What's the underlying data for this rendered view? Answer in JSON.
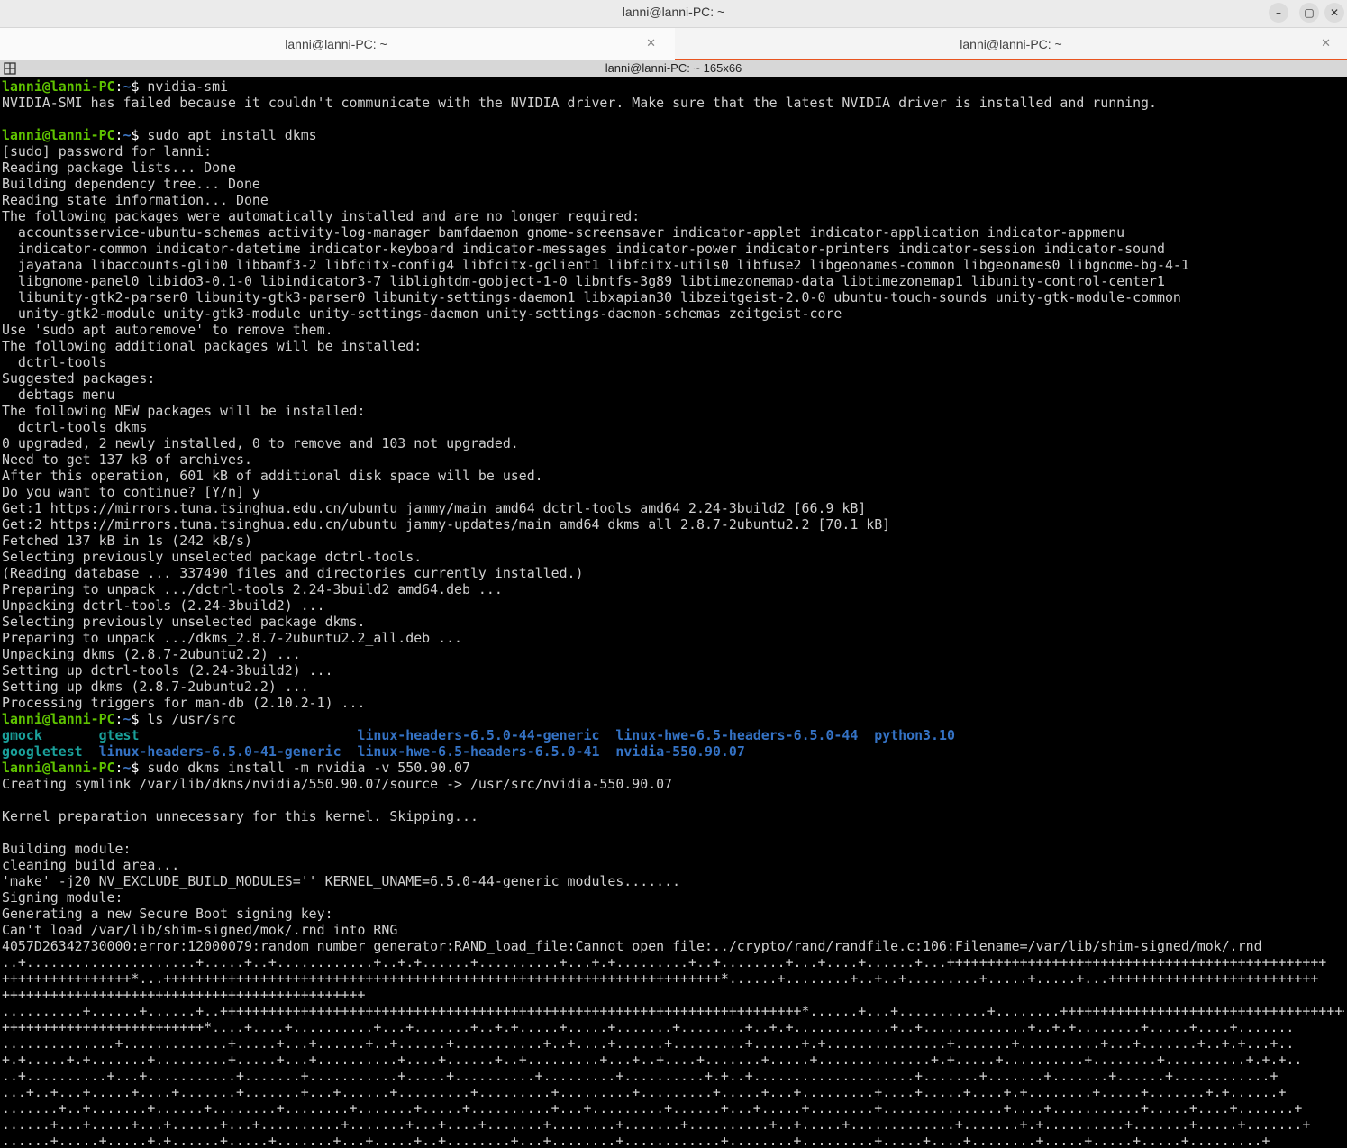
{
  "window": {
    "title": "lanni@lanni-PC: ~",
    "controls": {
      "minimize": "–",
      "maximize": "▢",
      "close": "✕"
    }
  },
  "tabs": [
    {
      "label": "lanni@lanni-PC: ~",
      "close": "✕",
      "active": false
    },
    {
      "label": "lanni@lanni-PC: ~",
      "close": "✕",
      "active": true
    }
  ],
  "header": {
    "title": "lanni@lanni-PC: ~ 165x66"
  },
  "colors": {
    "accent": "#e95420",
    "prompt_user": "#5fc300",
    "prompt_path": "#3f78c6",
    "dir_teal": "#1aa19b",
    "dir_blue": "#3472c4",
    "bg": "#000000"
  },
  "terminal": {
    "lines": [
      {
        "type": "prompt",
        "user": "lanni@lanni-PC",
        "path": "~",
        "cmd": " nvidia-smi"
      },
      {
        "type": "out",
        "text": "NVIDIA-SMI has failed because it couldn't communicate with the NVIDIA driver. Make sure that the latest NVIDIA driver is installed and running."
      },
      {
        "type": "out",
        "text": ""
      },
      {
        "type": "prompt",
        "user": "lanni@lanni-PC",
        "path": "~",
        "cmd": " sudo apt install dkms"
      },
      {
        "type": "out",
        "text": "[sudo] password for lanni:"
      },
      {
        "type": "out",
        "text": "Reading package lists... Done"
      },
      {
        "type": "out",
        "text": "Building dependency tree... Done"
      },
      {
        "type": "out",
        "text": "Reading state information... Done"
      },
      {
        "type": "out",
        "text": "The following packages were automatically installed and are no longer required:"
      },
      {
        "type": "out",
        "text": "  accountsservice-ubuntu-schemas activity-log-manager bamfdaemon gnome-screensaver indicator-applet indicator-application indicator-appmenu"
      },
      {
        "type": "out",
        "text": "  indicator-common indicator-datetime indicator-keyboard indicator-messages indicator-power indicator-printers indicator-session indicator-sound"
      },
      {
        "type": "out",
        "text": "  jayatana libaccounts-glib0 libbamf3-2 libfcitx-config4 libfcitx-gclient1 libfcitx-utils0 libfuse2 libgeonames-common libgeonames0 libgnome-bg-4-1"
      },
      {
        "type": "out",
        "text": "  libgnome-panel0 libido3-0.1-0 libindicator3-7 liblightdm-gobject-1-0 libntfs-3g89 libtimezonemap-data libtimezonemap1 libunity-control-center1"
      },
      {
        "type": "out",
        "text": "  libunity-gtk2-parser0 libunity-gtk3-parser0 libunity-settings-daemon1 libxapian30 libzeitgeist-2.0-0 ubuntu-touch-sounds unity-gtk-module-common"
      },
      {
        "type": "out",
        "text": "  unity-gtk2-module unity-gtk3-module unity-settings-daemon unity-settings-daemon-schemas zeitgeist-core"
      },
      {
        "type": "out",
        "text": "Use 'sudo apt autoremove' to remove them."
      },
      {
        "type": "out",
        "text": "The following additional packages will be installed:"
      },
      {
        "type": "out",
        "text": "  dctrl-tools"
      },
      {
        "type": "out",
        "text": "Suggested packages:"
      },
      {
        "type": "out",
        "text": "  debtags menu"
      },
      {
        "type": "out",
        "text": "The following NEW packages will be installed:"
      },
      {
        "type": "out",
        "text": "  dctrl-tools dkms"
      },
      {
        "type": "out",
        "text": "0 upgraded, 2 newly installed, 0 to remove and 103 not upgraded."
      },
      {
        "type": "out",
        "text": "Need to get 137 kB of archives."
      },
      {
        "type": "out",
        "text": "After this operation, 601 kB of additional disk space will be used."
      },
      {
        "type": "out",
        "text": "Do you want to continue? [Y/n] y"
      },
      {
        "type": "out",
        "text": "Get:1 https://mirrors.tuna.tsinghua.edu.cn/ubuntu jammy/main amd64 dctrl-tools amd64 2.24-3build2 [66.9 kB]"
      },
      {
        "type": "out",
        "text": "Get:2 https://mirrors.tuna.tsinghua.edu.cn/ubuntu jammy-updates/main amd64 dkms all 2.8.7-2ubuntu2.2 [70.1 kB]"
      },
      {
        "type": "out",
        "text": "Fetched 137 kB in 1s (242 kB/s)"
      },
      {
        "type": "out",
        "text": "Selecting previously unselected package dctrl-tools."
      },
      {
        "type": "out",
        "text": "(Reading database ... 337490 files and directories currently installed.)"
      },
      {
        "type": "out",
        "text": "Preparing to unpack .../dctrl-tools_2.24-3build2_amd64.deb ..."
      },
      {
        "type": "out",
        "text": "Unpacking dctrl-tools (2.24-3build2) ..."
      },
      {
        "type": "out",
        "text": "Selecting previously unselected package dkms."
      },
      {
        "type": "out",
        "text": "Preparing to unpack .../dkms_2.8.7-2ubuntu2.2_all.deb ..."
      },
      {
        "type": "out",
        "text": "Unpacking dkms (2.8.7-2ubuntu2.2) ..."
      },
      {
        "type": "out",
        "text": "Setting up dctrl-tools (2.24-3build2) ..."
      },
      {
        "type": "out",
        "text": "Setting up dkms (2.8.7-2ubuntu2.2) ..."
      },
      {
        "type": "out",
        "text": "Processing triggers for man-db (2.10.2-1) ..."
      },
      {
        "type": "prompt",
        "user": "lanni@lanni-PC",
        "path": "~",
        "cmd": " ls /usr/src"
      },
      {
        "type": "ls",
        "cells": [
          {
            "text": "gmock       ",
            "cls": "dir-green"
          },
          {
            "text": "gtest                           ",
            "cls": "dir-green"
          },
          {
            "text": "linux-headers-6.5.0-44-generic",
            "cls": "dir-blue"
          },
          {
            "text": "  ",
            "cls": ""
          },
          {
            "text": "linux-hwe-6.5-headers-6.5.0-44",
            "cls": "dir-blue"
          },
          {
            "text": "  ",
            "cls": ""
          },
          {
            "text": "python3.10",
            "cls": "dir-blue"
          }
        ]
      },
      {
        "type": "ls",
        "cells": [
          {
            "text": "googletest",
            "cls": "dir-green"
          },
          {
            "text": "  ",
            "cls": ""
          },
          {
            "text": "linux-headers-6.5.0-41-generic",
            "cls": "dir-blue"
          },
          {
            "text": "  ",
            "cls": ""
          },
          {
            "text": "linux-hwe-6.5-headers-6.5.0-41",
            "cls": "dir-blue"
          },
          {
            "text": "  ",
            "cls": ""
          },
          {
            "text": "nvidia-550.90.07",
            "cls": "dir-blue"
          }
        ]
      },
      {
        "type": "prompt",
        "user": "lanni@lanni-PC",
        "path": "~",
        "cmd": " sudo dkms install -m nvidia -v 550.90.07"
      },
      {
        "type": "out",
        "text": "Creating symlink /var/lib/dkms/nvidia/550.90.07/source -> /usr/src/nvidia-550.90.07"
      },
      {
        "type": "out",
        "text": ""
      },
      {
        "type": "out",
        "text": "Kernel preparation unnecessary for this kernel. Skipping..."
      },
      {
        "type": "out",
        "text": ""
      },
      {
        "type": "out",
        "text": "Building module:"
      },
      {
        "type": "out",
        "text": "cleaning build area..."
      },
      {
        "type": "out",
        "text": "'make' -j20 NV_EXCLUDE_BUILD_MODULES='' KERNEL_UNAME=6.5.0-44-generic modules......."
      },
      {
        "type": "out",
        "text": "Signing module:"
      },
      {
        "type": "out",
        "text": "Generating a new Secure Boot signing key:"
      },
      {
        "type": "out",
        "text": "Can't load /var/lib/shim-signed/mok/.rnd into RNG"
      },
      {
        "type": "out",
        "text": "4057D26342730000:error:12000079:random number generator:RAND_load_file:Cannot open file:../crypto/rand/randfile.c:106:Filename=/var/lib/shim-signed/mok/.rnd"
      },
      {
        "type": "out",
        "text": "..+.....................+.....+..+............+..+.+......+..........+...+.+.........+..+........+...+....+......+...+++++++++++++++++++++++++++++++++++++++++++++++"
      },
      {
        "type": "out",
        "text": "++++++++++++++++*...+++++++++++++++++++++++++++++++++++++++++++++++++++++++++++++++++++++*......+........+..+..+.........+.....+.....+...++++++++++++++++++++++++++"
      },
      {
        "type": "out",
        "text": "+++++++++++++++++++++++++++++++++++++++++++++"
      },
      {
        "type": "out",
        "text": "..........+......+......+..++++++++++++++++++++++++++++++++++++++++++++++++++++++++++++++++++++++++*......+...+...........+........+++++++++++++++++++++++++++++++++++++"
      },
      {
        "type": "out",
        "text": "+++++++++++++++++++++++++*....+....+..........+...+.......+..+.+.....+.....+.......+........+..+.+............+..+.............+..+.+........+.....+....+......."
      },
      {
        "type": "out",
        "text": "..............+.............+.....+...+......+..+......+...........+..+....+......+.........+......+.+...............+.......+..........+...+.......+..+.+...+.."
      },
      {
        "type": "out",
        "text": "+.+.....+.+.......+.........+.....+...+..........+....+......+..+.........+...+..+....+.......+.....+..............+.+.....+..........+........+..........+.+.+.."
      },
      {
        "type": "out",
        "text": "..+..........+...+...........+.......+...........+.....+..........+.........+..........+.+..+....................+.......+.......+.......+......+............+"
      },
      {
        "type": "out",
        "text": "...+..+...+.....+....+.......+.......+...+......+.........+.........+.........+.........+.....+...+.........+....+.....+....+.+........+.....+.......+.+......+"
      },
      {
        "type": "out",
        "text": ".......+..+.......+......+........+........+.......+.....+..........+...+.........+......+...+.....+........+...............+....+...........+.....+....+.......+"
      },
      {
        "type": "out",
        "text": "......+...+.....+...+......+...+..........+.......+...+....+.......+........+.......+..........+..+.....+.............+.......+.+..........+.......+.....+.......+"
      },
      {
        "type": "out",
        "text": "......+.....+.....+.+......+.....+.......+...+.....+..+........+...+........+............+........+.........+.....+....+........+.....+.....+.....+.........+"
      }
    ]
  }
}
